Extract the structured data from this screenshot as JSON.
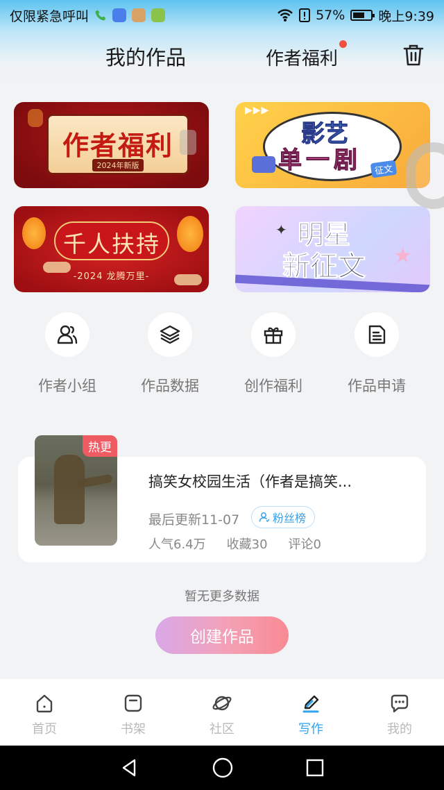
{
  "status_bar": {
    "left_text": "仅限紧急呼叫",
    "battery": "57%",
    "time": "晚上9:39"
  },
  "header": {
    "tab_works": "我的作品",
    "tab_welfare": "作者福利"
  },
  "banners": {
    "b1": {
      "title": "作者福利",
      "subtitle": "2024年新版"
    },
    "b2": {
      "line1": "影艺",
      "line2": "单一剧",
      "tag": "征文"
    },
    "b3": {
      "title": "千人扶持",
      "subtitle": "-2024 龙腾万里-"
    },
    "b4": {
      "line1": "明星",
      "line2": "新征文"
    }
  },
  "quick_nav": [
    {
      "label": "作者小组",
      "icon": "users-icon"
    },
    {
      "label": "作品数据",
      "icon": "layers-icon"
    },
    {
      "label": "创作福利",
      "icon": "gift-icon"
    },
    {
      "label": "作品申请",
      "icon": "document-icon"
    }
  ],
  "work": {
    "badge": "热更",
    "title": "搞笑女校园生活（作者是搞笑...",
    "updated": "最后更新11-07",
    "fan_chip": "粉丝榜",
    "popularity": "人气6.4万",
    "favorites": "收藏30",
    "comments": "评论0"
  },
  "no_more": "暂无更多数据",
  "create_button": "创建作品",
  "tabbar": [
    {
      "label": "首页",
      "icon": "home-icon"
    },
    {
      "label": "书架",
      "icon": "bookshelf-icon"
    },
    {
      "label": "社区",
      "icon": "planet-icon"
    },
    {
      "label": "写作",
      "icon": "pen-icon",
      "active": true
    },
    {
      "label": "我的",
      "icon": "chat-icon"
    }
  ],
  "colors": {
    "accent": "#2ea4f2",
    "badge": "#ef5b63",
    "red_dot": "#f0523e"
  }
}
